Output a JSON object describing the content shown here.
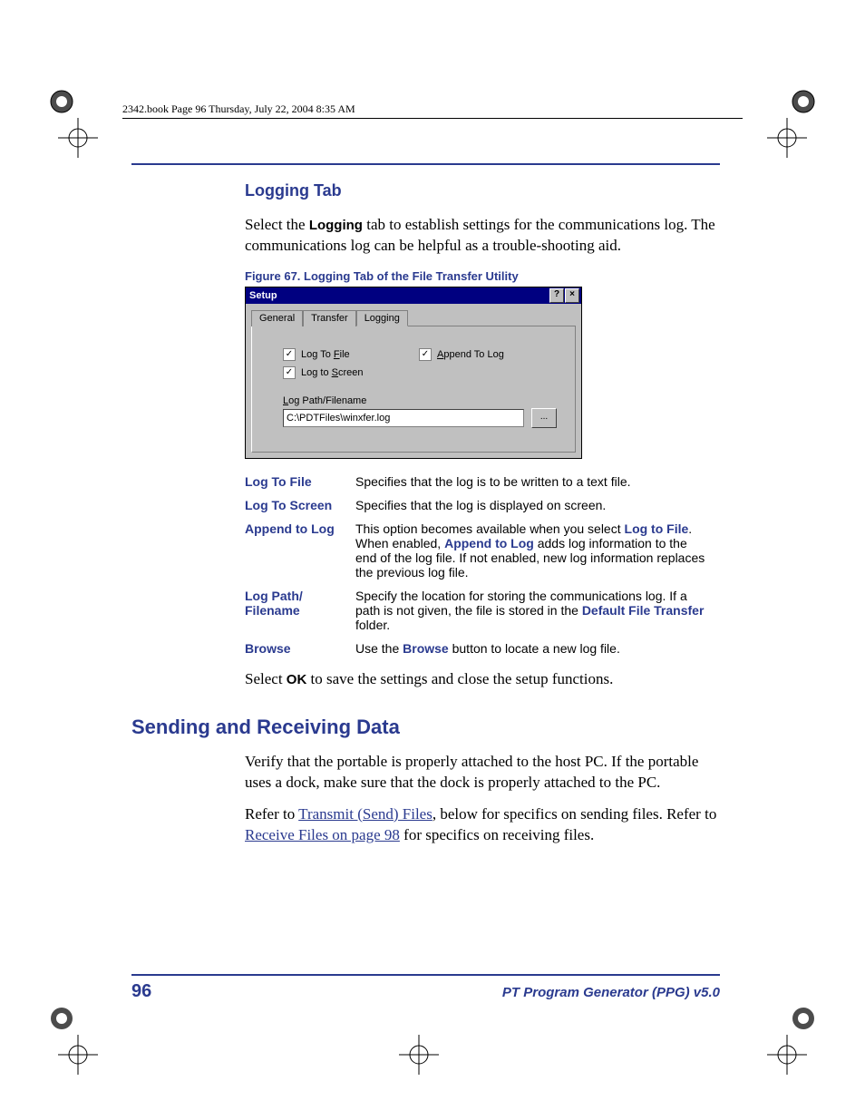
{
  "header_line": "2342.book  Page 96  Thursday, July 22, 2004  8:35 AM",
  "sec1_title": "Logging Tab",
  "sec1_para_a": "Select the ",
  "sec1_para_b_strong": "Logging",
  "sec1_para_c": " tab to establish settings for the communications log. The communications log can be helpful as a trouble-shooting aid.",
  "figure_caption": "Figure 67. Logging Tab of the File Transfer Utility",
  "dialog": {
    "title": "Setup",
    "help_btn": "?",
    "close_btn": "×",
    "tabs": [
      "General",
      "Transfer",
      "Logging"
    ],
    "active_tab_index": 2,
    "chk_log_to_file": "Log To File",
    "chk_log_to_file_ul": "F",
    "chk_append": "Append To Log",
    "chk_append_ul": "A",
    "chk_log_to_screen": "Log to Screen",
    "chk_log_to_screen_ul": "S",
    "label_path": "Log Path/Filename",
    "label_path_ul": "L",
    "path_value": "C:\\PDTFiles\\winxfer.log",
    "browse_btn": "..."
  },
  "defs": [
    {
      "term": "Log To File",
      "desc_parts": [
        {
          "t": "Specifies that the log is to be written to a text file."
        }
      ]
    },
    {
      "term": "Log To Screen",
      "desc_parts": [
        {
          "t": "Specifies that the log is displayed on screen."
        }
      ]
    },
    {
      "term": "Append to Log",
      "desc_parts": [
        {
          "t": "This option becomes available when you select "
        },
        {
          "b": "Log to File"
        },
        {
          "t": ". When enabled, "
        },
        {
          "b": "Append to Log"
        },
        {
          "t": " adds log information to the end of the log file. If not enabled, new log information replaces the previous log file."
        }
      ]
    },
    {
      "term": "Log Path/\nFilename",
      "desc_parts": [
        {
          "t": "Specify the location for storing the communications log. If a path is not given, the file is stored in the "
        },
        {
          "b": "Default File Transfer"
        },
        {
          "t": " folder."
        }
      ]
    },
    {
      "term": "Browse",
      "desc_parts": [
        {
          "t": "Use the "
        },
        {
          "b": "Browse"
        },
        {
          "t": " button to locate a new log file."
        }
      ]
    }
  ],
  "close_para_a": "Select ",
  "close_para_b_strong": "OK",
  "close_para_c": " to save the settings and close the setup functions.",
  "sec2_title": "Sending and Receiving Data",
  "sec2_p1": "Verify that the portable is properly attached to the host PC. If the portable uses a dock, make sure that the dock is properly attached to the PC.",
  "sec2_p2_a": "Refer to ",
  "sec2_p2_link1": "Transmit (Send) Files",
  "sec2_p2_b": ", below for specifics on sending files. Refer to ",
  "sec2_p2_link2": "Receive Files on page 98",
  "sec2_p2_c": " for specifics on receiving files.",
  "footer": {
    "page": "96",
    "title": "PT Program Generator (PPG)  v5.0"
  }
}
